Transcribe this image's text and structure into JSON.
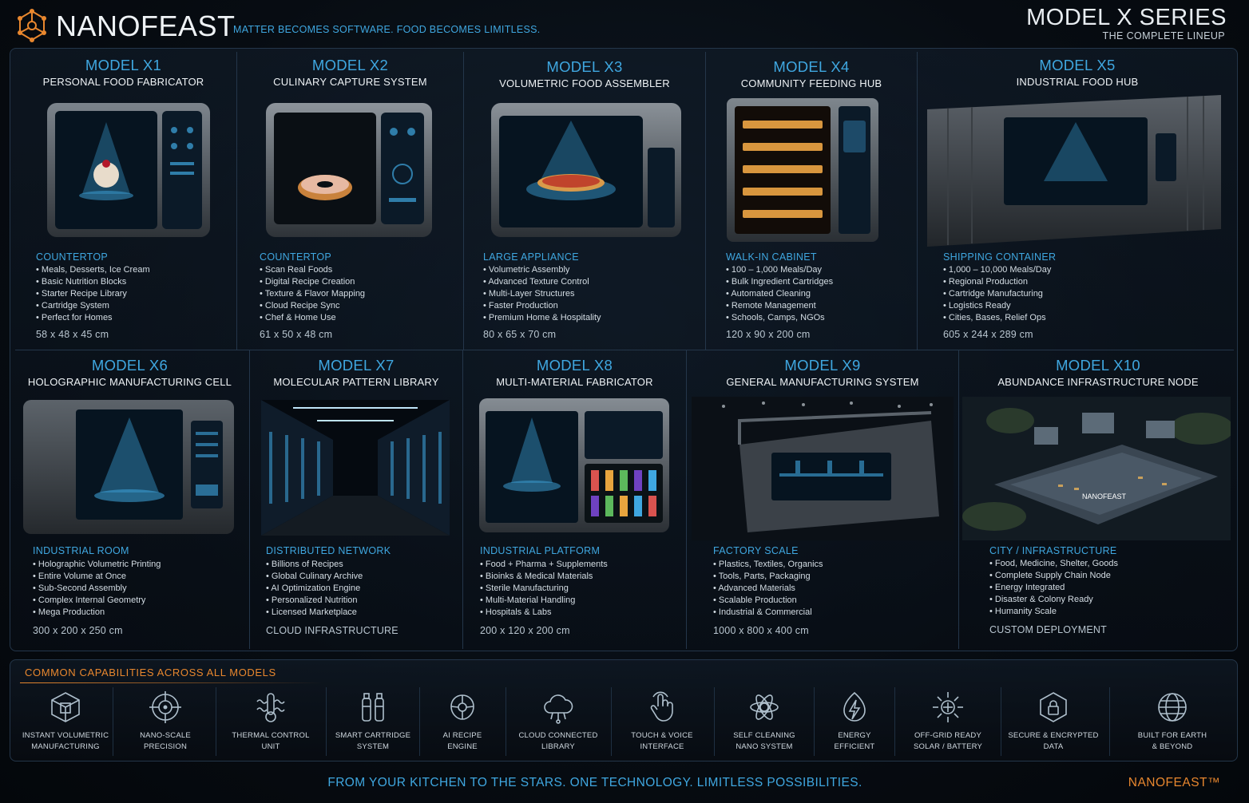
{
  "header": {
    "brand": "NANOFEAST",
    "tagline": "MATTER BECOMES SOFTWARE. FOOD BECOMES LIMITLESS.",
    "series_title": "MODEL X SERIES",
    "series_sub": "THE COMPLETE LINEUP",
    "logo_icon": "molecule-icon",
    "brand_color": "#e8872e",
    "accent_color": "#3fa7e0"
  },
  "models": [
    {
      "title": "MODEL X1",
      "subtitle": "PERSONAL FOOD FABRICATOR",
      "image": "countertop-fabricator-sundae-image",
      "category": "COUNTERTOP",
      "features": [
        "Meals, Desserts, Ice Cream",
        "Basic Nutrition Blocks",
        "Starter Recipe Library",
        "Cartridge System",
        "Perfect for Homes"
      ],
      "dimensions": "58 x 48 x 45 cm"
    },
    {
      "title": "MODEL X2",
      "subtitle": "CULINARY CAPTURE SYSTEM",
      "image": "countertop-scanner-donut-image",
      "category": "COUNTERTOP",
      "features": [
        "Scan Real Foods",
        "Digital Recipe Creation",
        "Texture & Flavor Mapping",
        "Cloud Recipe Sync",
        "Chef & Home Use"
      ],
      "dimensions": "61 x 50 x 48 cm"
    },
    {
      "title": "MODEL X3",
      "subtitle": "VOLUMETRIC FOOD ASSEMBLER",
      "image": "large-appliance-pizza-image",
      "category": "LARGE APPLIANCE",
      "features": [
        "Volumetric Assembly",
        "Advanced Texture Control",
        "Multi-Layer Structures",
        "Faster Production",
        "Premium Home & Hospitality"
      ],
      "dimensions": "80 x 65 x 70 cm"
    },
    {
      "title": "MODEL X4",
      "subtitle": "COMMUNITY FEEDING HUB",
      "image": "walk-in-cabinet-trays-image",
      "category": "WALK-IN CABINET",
      "features": [
        "100 – 1,000 Meals/Day",
        "Bulk Ingredient Cartridges",
        "Automated Cleaning",
        "Remote Management",
        "Schools, Camps, NGOs"
      ],
      "dimensions": "120 x 90 x 200 cm"
    },
    {
      "title": "MODEL X5",
      "subtitle": "INDUSTRIAL FOOD HUB",
      "image": "shipping-container-hub-image",
      "category": "SHIPPING CONTAINER",
      "features": [
        "1,000 – 10,000 Meals/Day",
        "Regional Production",
        "Cartridge Manufacturing",
        "Logistics Ready",
        "Cities, Bases, Relief Ops"
      ],
      "dimensions": "605 x 244 x 289 cm"
    },
    {
      "title": "MODEL X6",
      "subtitle": "HOLOGRAPHIC MANUFACTURING CELL",
      "image": "holographic-room-image",
      "category": "INDUSTRIAL ROOM",
      "features": [
        "Holographic Volumetric Printing",
        "Entire Volume at Once",
        "Sub-Second Assembly",
        "Complex Internal Geometry",
        "Mega Production"
      ],
      "dimensions": "300 x 200 x 250 cm"
    },
    {
      "title": "MODEL X7",
      "subtitle": "MOLECULAR PATTERN LIBRARY",
      "image": "server-corridor-image",
      "category": "DISTRIBUTED NETWORK",
      "features": [
        "Billions of Recipes",
        "Global Culinary Archive",
        "AI Optimization Engine",
        "Personalized Nutrition",
        "Licensed Marketplace"
      ],
      "dimensions": "CLOUD INFRASTRUCTURE"
    },
    {
      "title": "MODEL X8",
      "subtitle": "MULTI-MATERIAL FABRICATOR",
      "image": "multi-material-fabricator-image",
      "category": "INDUSTRIAL PLATFORM",
      "features": [
        "Food + Pharma + Supplements",
        "Bioinks & Medical Materials",
        "Sterile Manufacturing",
        "Multi-Material Handling",
        "Hospitals & Labs"
      ],
      "dimensions": "200 x 120 x 200 cm"
    },
    {
      "title": "MODEL X9",
      "subtitle": "GENERAL MANUFACTURING SYSTEM",
      "image": "factory-floor-system-image",
      "category": "FACTORY SCALE",
      "features": [
        "Plastics, Textiles, Organics",
        "Tools, Parts, Packaging",
        "Advanced Materials",
        "Scalable Production",
        "Industrial & Commercial"
      ],
      "dimensions": "1000 x 800 x 400 cm"
    },
    {
      "title": "MODEL X10",
      "subtitle": "ABUNDANCE INFRASTRUCTURE NODE",
      "image": "city-infrastructure-aerial-image",
      "category": "CITY / INFRASTRUCTURE",
      "features": [
        "Food, Medicine, Shelter, Goods",
        "Complete Supply Chain Node",
        "Energy Integrated",
        "Disaster & Colony Ready",
        "Humanity Scale"
      ],
      "dimensions": "CUSTOM DEPLOYMENT",
      "image_logo": "NANOFEAST"
    }
  ],
  "capabilities": {
    "title": "COMMON CAPABILITIES ACROSS ALL MODELS",
    "items": [
      {
        "label": "INSTANT VOLUMETRIC\nMANUFACTURING",
        "icon": "volumetric-cube-icon"
      },
      {
        "label": "NANO-SCALE\nPRECISION",
        "icon": "precision-target-icon"
      },
      {
        "label": "THERMAL CONTROL\nUNIT",
        "icon": "thermal-wave-icon"
      },
      {
        "label": "SMART CARTRIDGE\nSYSTEM",
        "icon": "cartridge-icon"
      },
      {
        "label": "AI RECIPE\nENGINE",
        "icon": "ai-brain-icon"
      },
      {
        "label": "CLOUD CONNECTED\nLIBRARY",
        "icon": "cloud-icon"
      },
      {
        "label": "TOUCH & VOICE\nINTERFACE",
        "icon": "touch-hand-icon"
      },
      {
        "label": "SELF CLEANING\nNANO SYSTEM",
        "icon": "nano-cleaning-icon"
      },
      {
        "label": "ENERGY\nEFFICIENT",
        "icon": "energy-bolt-icon"
      },
      {
        "label": "OFF-GRID READY\nSOLAR / BATTERY",
        "icon": "solar-sun-icon"
      },
      {
        "label": "SECURE & ENCRYPTED\nDATA",
        "icon": "secure-shield-icon"
      },
      {
        "label": "BUILT FOR EARTH\n& BEYOND",
        "icon": "earth-globe-icon"
      }
    ]
  },
  "footer": {
    "tagline": "FROM YOUR KITCHEN TO THE STARS. ONE TECHNOLOGY. LIMITLESS POSSIBILITIES.",
    "brand": "NANOFEAST™"
  }
}
